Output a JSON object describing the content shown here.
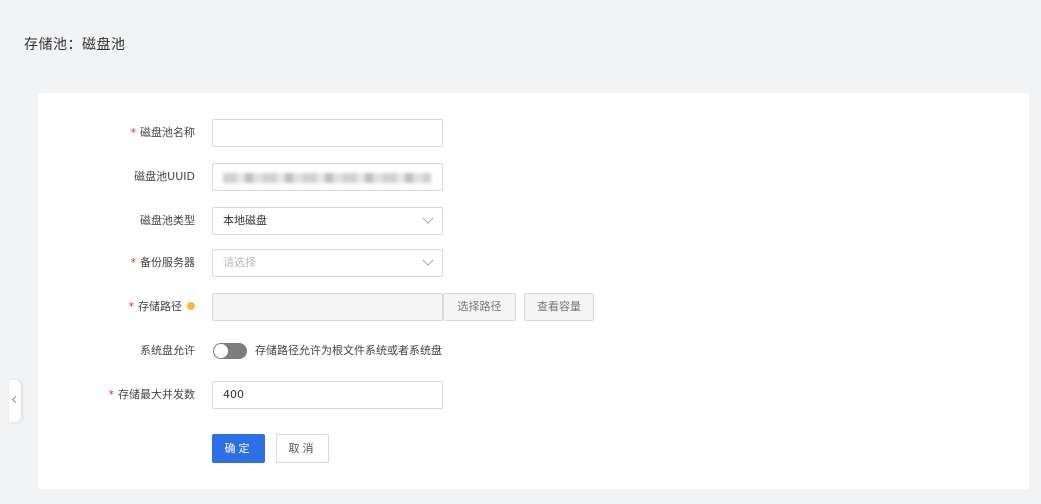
{
  "header": {
    "title": "存储池：磁盘池"
  },
  "form": {
    "name": {
      "label": "磁盘池名称",
      "required": true,
      "value": ""
    },
    "uuid": {
      "label": "磁盘池UUID",
      "required": false
    },
    "type": {
      "label": "磁盘池类型",
      "required": false,
      "value": "本地磁盘"
    },
    "backup_server": {
      "label": "备份服务器",
      "required": true,
      "placeholder": "请选择"
    },
    "storage_path": {
      "label": "存储路径",
      "required": true,
      "value": "",
      "select_path_label": "选择路径",
      "check_capacity_label": "查看容量"
    },
    "system_disk": {
      "label": "系统盘允许",
      "toggle_on": false,
      "toggle_text": "存储路径允许为根文件系统或者系统盘"
    },
    "max_concurrency": {
      "label": "存储最大并发数",
      "required": true,
      "value": "400"
    }
  },
  "actions": {
    "confirm_label": "确定",
    "cancel_label": "取消"
  },
  "colors": {
    "primary": "#2f6fe6",
    "required": "#f5222d",
    "hint": "#f6b93b"
  },
  "icons": {
    "hint": "info-dot-icon",
    "dropdown": "chevron-down-icon",
    "sidebar_toggle": "chevron-left-icon"
  }
}
